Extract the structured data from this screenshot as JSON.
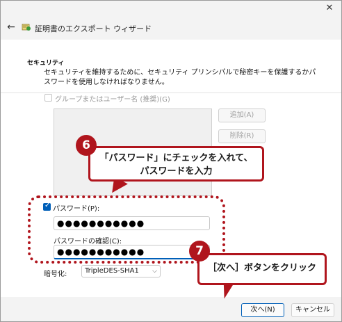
{
  "window": {
    "close_glyph": "✕",
    "back_glyph": "←",
    "title": "証明書のエクスポート ウィザード"
  },
  "security": {
    "heading": "セキュリティ",
    "description": "セキュリティを維持するために、セキュリティ プリンシパルで秘密キーを保護するかパスワードを使用しなければなりません。",
    "group_checkbox_label": "グループまたはユーザー名 (推奨)(G)",
    "group_checked": false,
    "add_button": "追加(A)",
    "delete_button": "削除(R)",
    "password_checkbox_label": "パスワード(P):",
    "password_checked": true,
    "password_value": "●●●●●●●●●●●",
    "confirm_label": "パスワードの確認(C):",
    "confirm_value": "●●●●●●●●●●●",
    "encryption_label": "暗号化:",
    "encryption_value": "TripleDES-SHA1",
    "encryption_arrow": "⌵"
  },
  "footer": {
    "next_button": "次へ(N)",
    "cancel_button": "キャンセル"
  },
  "annotations": {
    "badge6": "6",
    "callout6_line1": "「パスワード」にチェックを入れて、",
    "callout6_line2": "パスワードを入力",
    "badge7": "7",
    "callout7": "［次へ］ボタンをクリック",
    "accent_color": "#b0151d"
  }
}
